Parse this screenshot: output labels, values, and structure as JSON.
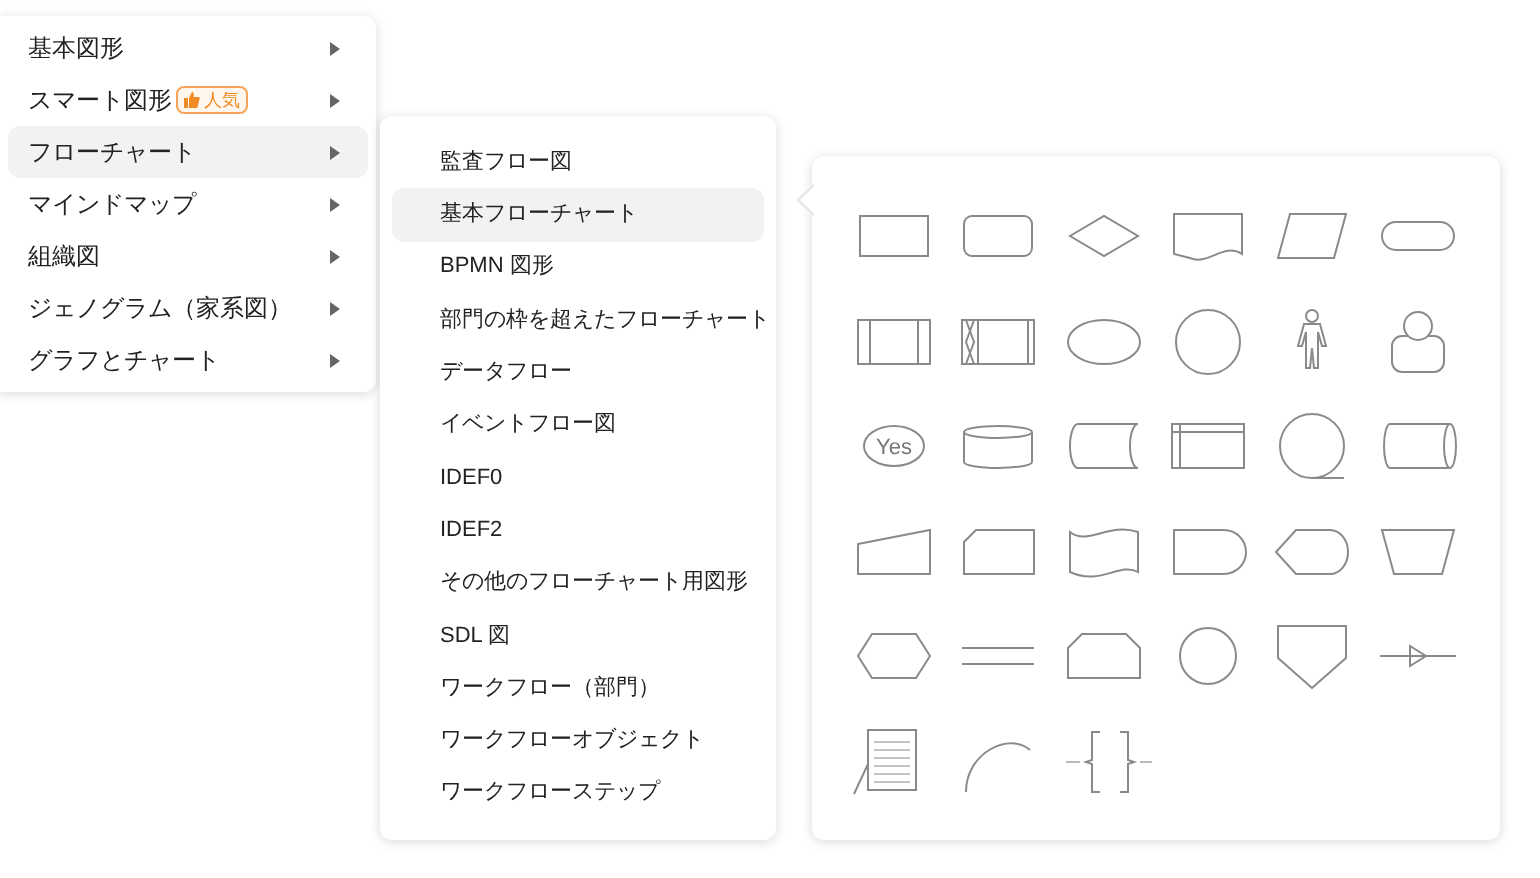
{
  "main_menu": [
    {
      "label": "基本図形",
      "selected": false
    },
    {
      "label": "スマート図形",
      "selected": false,
      "badge": "人気"
    },
    {
      "label": "フローチャート",
      "selected": true
    },
    {
      "label": "マインドマップ",
      "selected": false
    },
    {
      "label": "組織図",
      "selected": false
    },
    {
      "label": "ジェノグラム（家系図）",
      "selected": false
    },
    {
      "label": "グラフとチャート",
      "selected": false
    }
  ],
  "submenu": [
    {
      "label": "監査フロー図",
      "selected": false
    },
    {
      "label": "基本フローチャート",
      "selected": true
    },
    {
      "label": "BPMN 図形",
      "selected": false
    },
    {
      "label": "部門の枠を超えたフローチャート",
      "selected": false
    },
    {
      "label": "データフロー",
      "selected": false
    },
    {
      "label": "イベントフロー図",
      "selected": false
    },
    {
      "label": "IDEF0",
      "selected": false
    },
    {
      "label": "IDEF2",
      "selected": false
    },
    {
      "label": "その他のフローチャート用図形",
      "selected": false
    },
    {
      "label": "SDL 図",
      "selected": false
    },
    {
      "label": "ワークフロー（部門）",
      "selected": false
    },
    {
      "label": "ワークフローオブジェクト",
      "selected": false
    },
    {
      "label": "ワークフローステップ",
      "selected": false
    }
  ],
  "shapes": [
    {
      "kind": "rectangle"
    },
    {
      "kind": "rounded"
    },
    {
      "kind": "diamond"
    },
    {
      "kind": "document"
    },
    {
      "kind": "parallelogram"
    },
    {
      "kind": "terminator"
    },
    {
      "kind": "predefined"
    },
    {
      "kind": "crossed"
    },
    {
      "kind": "ellipse"
    },
    {
      "kind": "circle"
    },
    {
      "kind": "figure"
    },
    {
      "kind": "user"
    },
    {
      "kind": "oval",
      "label": "Yes"
    },
    {
      "kind": "cylinder"
    },
    {
      "kind": "stored"
    },
    {
      "kind": "storage"
    },
    {
      "kind": "tailcircle"
    },
    {
      "kind": "drum"
    },
    {
      "kind": "manualinput"
    },
    {
      "kind": "card"
    },
    {
      "kind": "tape"
    },
    {
      "kind": "delay"
    },
    {
      "kind": "display"
    },
    {
      "kind": "trapezoid"
    },
    {
      "kind": "hexagon"
    },
    {
      "kind": "parallel"
    },
    {
      "kind": "looplimit"
    },
    {
      "kind": "smallcircle"
    },
    {
      "kind": "offpage"
    },
    {
      "kind": "arrowline"
    },
    {
      "kind": "annotation"
    },
    {
      "kind": "arc"
    },
    {
      "kind": "braces"
    }
  ]
}
